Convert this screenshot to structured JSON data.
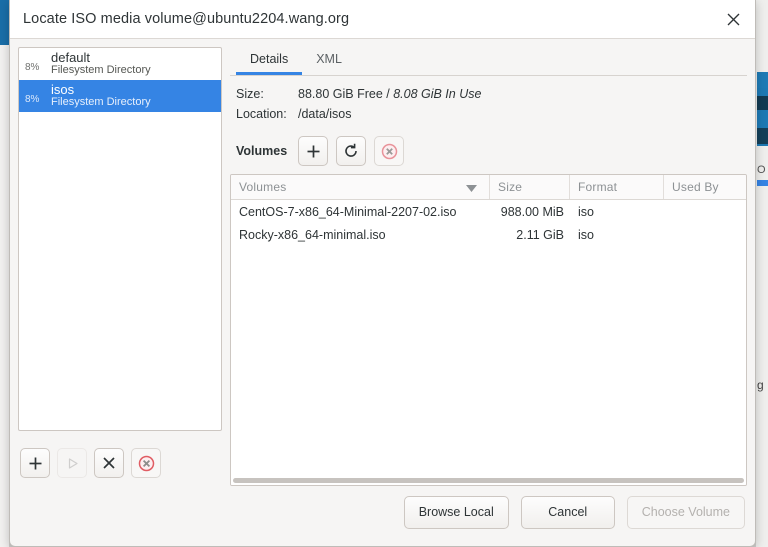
{
  "window": {
    "title": "Locate ISO media volume@ubuntu2204.wang.org",
    "close_icon": "close-icon"
  },
  "pools": {
    "items": [
      {
        "percent": "8%",
        "name": "default",
        "type": "Filesystem Directory",
        "selected": false
      },
      {
        "percent": "8%",
        "name": "isos",
        "type": "Filesystem Directory",
        "selected": true
      }
    ],
    "toolbar": [
      {
        "icon": "plus-icon",
        "name": "add-pool-button",
        "enabled": true
      },
      {
        "icon": "play-icon",
        "name": "start-pool-button",
        "enabled": false
      },
      {
        "icon": "x-icon",
        "name": "stop-pool-button",
        "enabled": true
      },
      {
        "icon": "delete-circle-icon",
        "name": "delete-pool-button",
        "enabled": true
      }
    ]
  },
  "detail": {
    "tabs": [
      {
        "label": "Details",
        "active": true
      },
      {
        "label": "XML",
        "active": false
      }
    ],
    "info": [
      {
        "label": "Size:",
        "value": "88.80 GiB Free / ",
        "value_italic": "8.08 GiB In Use"
      },
      {
        "label": "Location:",
        "value": "/data/isos",
        "value_italic": ""
      }
    ],
    "volumes_title": "Volumes",
    "volumes_toolbar": [
      {
        "icon": "plus-icon",
        "name": "add-volume-button",
        "enabled": true
      },
      {
        "icon": "refresh-icon",
        "name": "refresh-volumes-button",
        "enabled": true
      },
      {
        "icon": "delete-circle-icon",
        "name": "delete-volume-button",
        "enabled": true
      }
    ],
    "table": {
      "columns": [
        "Volumes",
        "Size",
        "Format",
        "Used By"
      ],
      "sort_column": "Volumes",
      "sort_direction": "descending",
      "rows": [
        {
          "volume": "CentOS-7-x86_64-Minimal-2207-02.iso",
          "size": "988.00 MiB",
          "format": "iso",
          "used_by": ""
        },
        {
          "volume": "Rocky-x86_64-minimal.iso",
          "size": "2.11 GiB",
          "format": "iso",
          "used_by": ""
        }
      ]
    }
  },
  "footer": {
    "browse_local": "Browse Local",
    "cancel": "Cancel",
    "choose_volume": "Choose Volume",
    "choose_volume_enabled": false
  },
  "colors": {
    "selection_blue": "#3584e4",
    "tab_accent": "#3584e4",
    "danger_red": "#e05c63",
    "dialog_bg": "#f6f5f4",
    "titlebar_bg": "#ffffff"
  }
}
